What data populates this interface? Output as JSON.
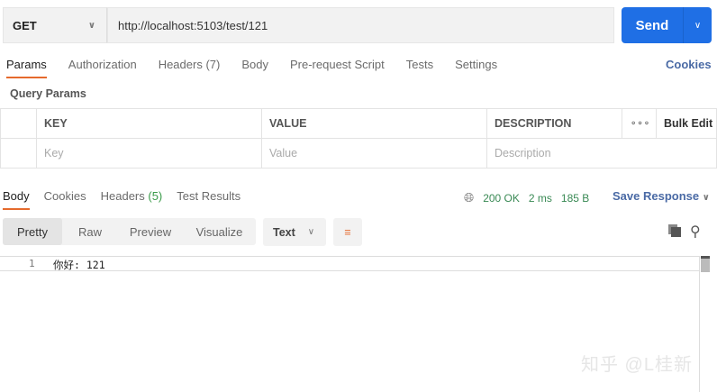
{
  "request": {
    "method": "GET",
    "url": "http://localhost:5103/test/121",
    "send_label": "Send"
  },
  "request_tabs": [
    {
      "label": "Params"
    },
    {
      "label": "Authorization"
    },
    {
      "label": "Headers",
      "count": "(7)"
    },
    {
      "label": "Body"
    },
    {
      "label": "Pre-request Script"
    },
    {
      "label": "Tests"
    },
    {
      "label": "Settings"
    }
  ],
  "cookies_link": "Cookies",
  "query_params": {
    "title": "Query Params",
    "headers": [
      "KEY",
      "VALUE",
      "DESCRIPTION",
      "Bulk Edit"
    ],
    "placeholders": [
      "Key",
      "Value",
      "Description"
    ]
  },
  "response_tabs": [
    {
      "label": "Body"
    },
    {
      "label": "Cookies"
    },
    {
      "label": "Headers",
      "count": "(5)"
    },
    {
      "label": "Test Results"
    }
  ],
  "status": {
    "code": "200 OK",
    "time": "2 ms",
    "size": "185 B"
  },
  "save_response": "Save Response",
  "view_modes": [
    "Pretty",
    "Raw",
    "Preview",
    "Visualize"
  ],
  "format": "Text",
  "body": {
    "line": "1",
    "text": "你好: 121"
  },
  "watermark": "知乎 @L桂新"
}
